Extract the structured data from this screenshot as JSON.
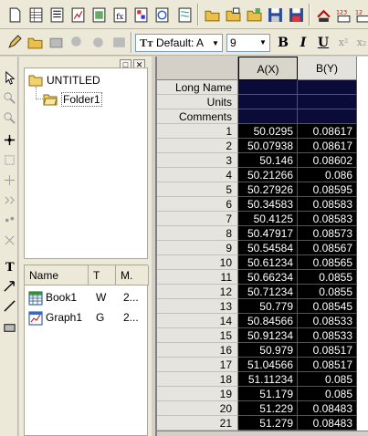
{
  "font": {
    "name": "Default: A",
    "size": "9"
  },
  "format_buttons": {
    "bold": "B",
    "italic": "I",
    "underline": "U",
    "superscript": "x²",
    "subscript": "x₂"
  },
  "explorer": {
    "root": "UNTITLED",
    "folder": "Folder1",
    "list_headers": [
      "Name",
      "T",
      "M."
    ],
    "items": [
      {
        "name": "Book1",
        "type": "W",
        "modified": "2..."
      },
      {
        "name": "Graph1",
        "type": "G",
        "modified": "2..."
      }
    ]
  },
  "worksheet": {
    "columns": [
      "A(X)",
      "B(Y)"
    ],
    "meta_rows": [
      "Long Name",
      "Units",
      "Comments"
    ],
    "rows": [
      {
        "n": "1",
        "a": "50.0295",
        "b": "0.08617"
      },
      {
        "n": "2",
        "a": "50.07938",
        "b": "0.08617"
      },
      {
        "n": "3",
        "a": "50.146",
        "b": "0.08602"
      },
      {
        "n": "4",
        "a": "50.21266",
        "b": "0.086"
      },
      {
        "n": "5",
        "a": "50.27926",
        "b": "0.08595"
      },
      {
        "n": "6",
        "a": "50.34583",
        "b": "0.08583"
      },
      {
        "n": "7",
        "a": "50.4125",
        "b": "0.08583"
      },
      {
        "n": "8",
        "a": "50.47917",
        "b": "0.08573"
      },
      {
        "n": "9",
        "a": "50.54584",
        "b": "0.08567"
      },
      {
        "n": "10",
        "a": "50.61234",
        "b": "0.08565"
      },
      {
        "n": "11",
        "a": "50.66234",
        "b": "0.0855"
      },
      {
        "n": "12",
        "a": "50.71234",
        "b": "0.0855"
      },
      {
        "n": "13",
        "a": "50.779",
        "b": "0.08545"
      },
      {
        "n": "14",
        "a": "50.84566",
        "b": "0.08533"
      },
      {
        "n": "15",
        "a": "50.91234",
        "b": "0.08533"
      },
      {
        "n": "16",
        "a": "50.979",
        "b": "0.08517"
      },
      {
        "n": "17",
        "a": "51.04566",
        "b": "0.08517"
      },
      {
        "n": "18",
        "a": "51.11234",
        "b": "0.085"
      },
      {
        "n": "19",
        "a": "51.179",
        "b": "0.085"
      },
      {
        "n": "20",
        "a": "51.229",
        "b": "0.08483"
      },
      {
        "n": "21",
        "a": "51.279",
        "b": "0.08483"
      }
    ]
  },
  "colors": {
    "meta_fill": "#0b0b3a",
    "data_fill": "#000000",
    "data_text": "#ffffff"
  }
}
